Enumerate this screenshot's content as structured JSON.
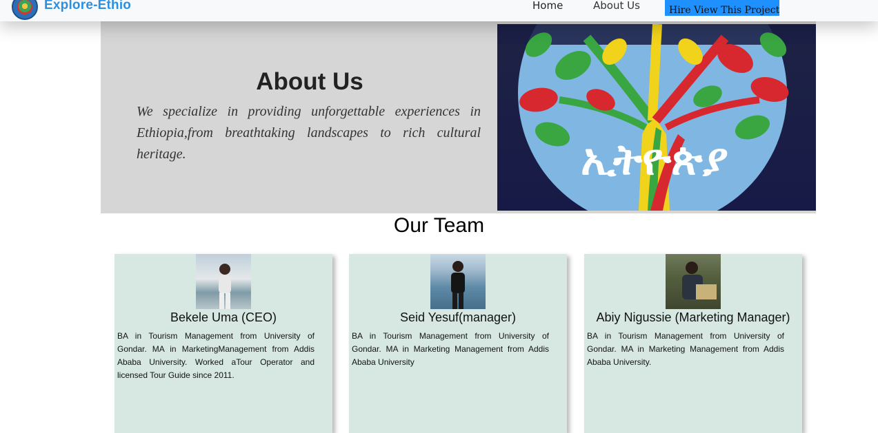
{
  "nav": {
    "brand": "Explore-Ethio",
    "links": [
      {
        "label": "Home"
      },
      {
        "label": "About Us"
      }
    ],
    "hire_button": "Hire View This Project"
  },
  "hero": {
    "title": "About Us",
    "description": "We specialize in providing unforgettable experiences in Ethiopia,from breathtaking landscapes to rich cultural heritage.",
    "image_text": "ኢትዮጵያ"
  },
  "team": {
    "title": "Our Team",
    "members": [
      {
        "name": "Bekele Uma (CEO)",
        "bio": "BA in Tourism Management from University of Gondar. MA in MarketingManagement from Addis Ababa University. Worked aTour Operator and licensed Tour Guide since 2011."
      },
      {
        "name": "Seid Yesuf(manager)",
        "bio": "BA in Tourism Management from University of Gondar. MA in Marketing Management from Addis Ababa University"
      },
      {
        "name": "Abiy Nigussie (Marketing Manager)",
        "bio": "BA in Tourism Management from University of Gondar. MA in Marketing Management from Addis Ababa University."
      }
    ]
  },
  "colors": {
    "brand_blue": "#2d8fe0",
    "hire_button": "#1e90ff",
    "hero_bg": "#d6d6d6",
    "card_bg": "#d7e8e3"
  }
}
